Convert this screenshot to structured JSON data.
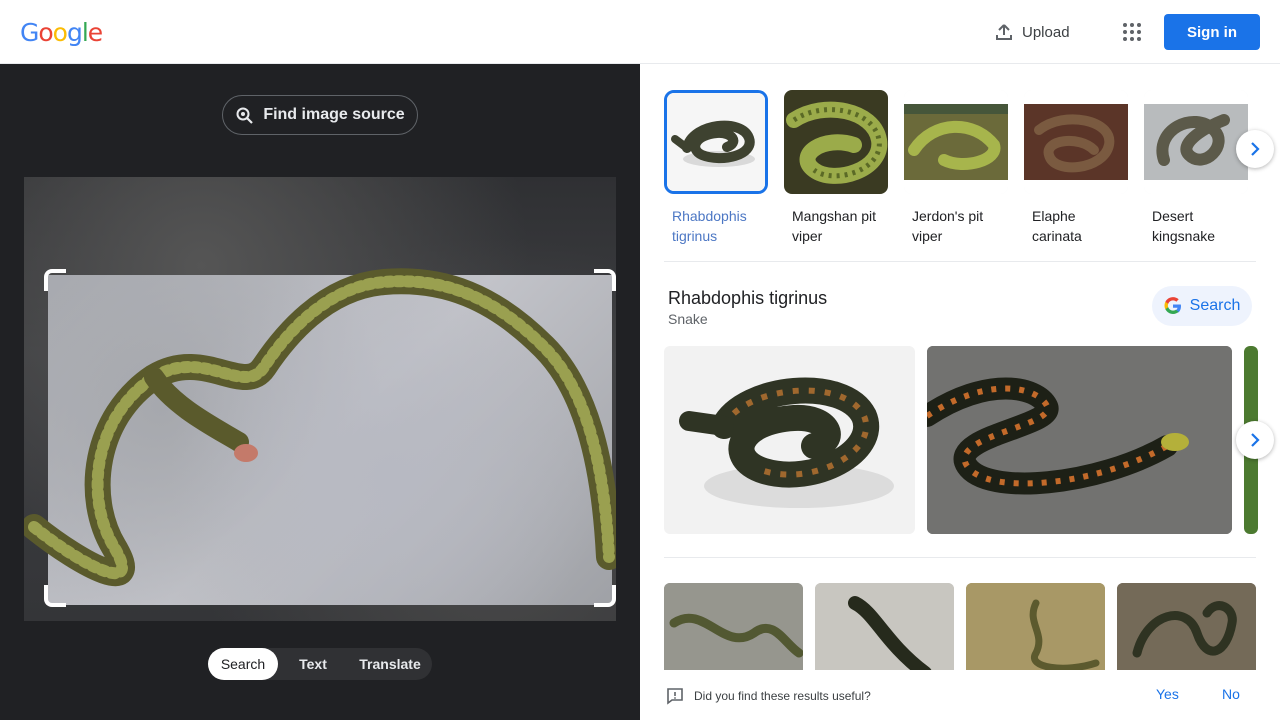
{
  "header": {
    "logo_letters": [
      "G",
      "o",
      "o",
      "g",
      "l",
      "e"
    ],
    "logo_colors": [
      "#4285f4",
      "#ea4335",
      "#fbbc05",
      "#4285f4",
      "#34a853",
      "#ea4335"
    ],
    "upload_label": "Upload",
    "signin_label": "Sign in"
  },
  "left": {
    "find_source_label": "Find image source",
    "modes": [
      {
        "label": "Search",
        "active": true
      },
      {
        "label": "Text",
        "active": false
      },
      {
        "label": "Translate",
        "active": false
      }
    ]
  },
  "matches": [
    {
      "label": "Rhabdophis tigrinus",
      "selected": true
    },
    {
      "label": "Mangshan pit viper",
      "selected": false
    },
    {
      "label": "Jerdon's pit viper",
      "selected": false
    },
    {
      "label": "Elaphe carinata",
      "selected": false
    },
    {
      "label": "Desert kingsnake",
      "selected": false
    }
  ],
  "entity": {
    "title": "Rhabdophis tigrinus",
    "subtitle": "Snake",
    "search_label": "Search"
  },
  "feedback": {
    "question": "Did you find these results useful?",
    "yes": "Yes",
    "no": "No"
  },
  "colors": {
    "accent": "#1a73e8",
    "dark_panel": "#202124"
  }
}
